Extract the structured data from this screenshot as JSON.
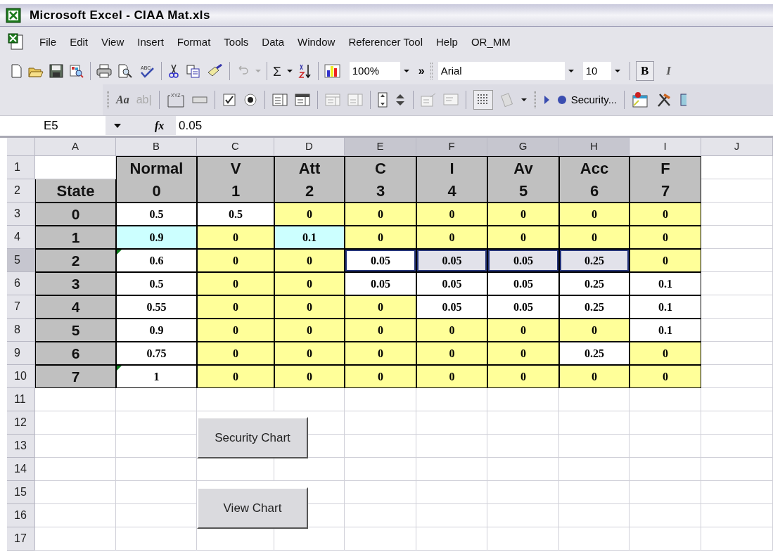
{
  "window": {
    "title": "Microsoft Excel - CIAA Mat.xls"
  },
  "menu": [
    {
      "label": "File"
    },
    {
      "label": "Edit"
    },
    {
      "label": "View"
    },
    {
      "label": "Insert"
    },
    {
      "label": "Format"
    },
    {
      "label": "Tools"
    },
    {
      "label": "Data"
    },
    {
      "label": "Window"
    },
    {
      "label": "Referencer Tool"
    },
    {
      "label": "Help"
    },
    {
      "label": "OR_MM"
    }
  ],
  "standard_toolbar": {
    "spelling_icon_text": "ABC",
    "sum": "Σ",
    "zoom": "100%",
    "overflow": "»",
    "font": "Arial",
    "font_size": "10",
    "bold": "B",
    "italic": "I"
  },
  "forms_toolbar": {
    "label_tool": "Aa",
    "edit_box_tool": "ab|",
    "group_box_text": "XYZ",
    "security_button": "Security..."
  },
  "formula_bar": {
    "name_box": "E5",
    "function_label": "fx",
    "formula": "0.05"
  },
  "columns": [
    {
      "label": "A",
      "selected": false
    },
    {
      "label": "B",
      "selected": false
    },
    {
      "label": "C",
      "selected": false
    },
    {
      "label": "D",
      "selected": false
    },
    {
      "label": "E",
      "selected": true
    },
    {
      "label": "F",
      "selected": true
    },
    {
      "label": "G",
      "selected": true
    },
    {
      "label": "H",
      "selected": true
    },
    {
      "label": "I",
      "selected": false
    },
    {
      "label": "J",
      "selected": false
    }
  ],
  "rows": [
    {
      "label": "1",
      "selected": false,
      "cells": [
        {
          "kind": "blank",
          "color": "#ffffff",
          "selected": false,
          "active": false,
          "flag": false
        },
        {
          "text": "Normal",
          "kind": "header",
          "color": "#c0c0c0",
          "selected": false,
          "active": false,
          "flag": false
        },
        {
          "text": "V",
          "kind": "header",
          "color": "#c0c0c0",
          "selected": false,
          "active": false,
          "flag": false
        },
        {
          "text": "Att",
          "kind": "header",
          "color": "#c0c0c0",
          "selected": false,
          "active": false,
          "flag": false
        },
        {
          "text": "C",
          "kind": "header",
          "color": "#c0c0c0",
          "selected": false,
          "active": false,
          "flag": false
        },
        {
          "text": "I",
          "kind": "header",
          "color": "#c0c0c0",
          "selected": false,
          "active": false,
          "flag": false
        },
        {
          "text": "Av",
          "kind": "header",
          "color": "#c0c0c0",
          "selected": false,
          "active": false,
          "flag": false
        },
        {
          "text": "Acc",
          "kind": "header",
          "color": "#c0c0c0",
          "selected": false,
          "active": false,
          "flag": false
        },
        {
          "text": "F",
          "kind": "header",
          "color": "#c0c0c0",
          "selected": false,
          "active": false,
          "flag": false
        }
      ]
    },
    {
      "label": "2",
      "selected": false,
      "cells": [
        {
          "text": "State",
          "kind": "header",
          "color": "#c0c0c0",
          "selected": false,
          "active": false,
          "flag": false
        },
        {
          "text": "0",
          "kind": "header",
          "color": "#c0c0c0",
          "selected": false,
          "active": false,
          "flag": false
        },
        {
          "text": "1",
          "kind": "header",
          "color": "#c0c0c0",
          "selected": false,
          "active": false,
          "flag": false
        },
        {
          "text": "2",
          "kind": "header",
          "color": "#c0c0c0",
          "selected": false,
          "active": false,
          "flag": false
        },
        {
          "text": "3",
          "kind": "header",
          "color": "#c0c0c0",
          "selected": false,
          "active": false,
          "flag": false
        },
        {
          "text": "4",
          "kind": "header",
          "color": "#c0c0c0",
          "selected": false,
          "active": false,
          "flag": false
        },
        {
          "text": "5",
          "kind": "header",
          "color": "#c0c0c0",
          "selected": false,
          "active": false,
          "flag": false
        },
        {
          "text": "6",
          "kind": "header",
          "color": "#c0c0c0",
          "selected": false,
          "active": false,
          "flag": false
        },
        {
          "text": "7",
          "kind": "header",
          "color": "#c0c0c0",
          "selected": false,
          "active": false,
          "flag": false
        }
      ]
    },
    {
      "label": "3",
      "selected": false,
      "cells": [
        {
          "text": "0",
          "kind": "label",
          "color": "#c0c0c0",
          "selected": false,
          "active": false,
          "flag": false
        },
        {
          "text": "0.5",
          "kind": "value",
          "color": "#ffffff",
          "selected": false,
          "active": false,
          "flag": false
        },
        {
          "text": "0.5",
          "kind": "value",
          "color": "#ffffff",
          "selected": false,
          "active": false,
          "flag": false
        },
        {
          "text": "0",
          "kind": "value",
          "color": "#ffff99",
          "selected": false,
          "active": false,
          "flag": false
        },
        {
          "text": "0",
          "kind": "value",
          "color": "#ffff99",
          "selected": false,
          "active": false,
          "flag": false
        },
        {
          "text": "0",
          "kind": "value",
          "color": "#ffff99",
          "selected": false,
          "active": false,
          "flag": false
        },
        {
          "text": "0",
          "kind": "value",
          "color": "#ffff99",
          "selected": false,
          "active": false,
          "flag": false
        },
        {
          "text": "0",
          "kind": "value",
          "color": "#ffff99",
          "selected": false,
          "active": false,
          "flag": false
        },
        {
          "text": "0",
          "kind": "value",
          "color": "#ffff99",
          "selected": false,
          "active": false,
          "flag": false
        }
      ]
    },
    {
      "label": "4",
      "selected": false,
      "cells": [
        {
          "text": "1",
          "kind": "label",
          "color": "#c0c0c0",
          "selected": false,
          "active": false,
          "flag": false
        },
        {
          "text": "0.9",
          "kind": "value",
          "color": "#ccffff",
          "selected": false,
          "active": false,
          "flag": false
        },
        {
          "text": "0",
          "kind": "value",
          "color": "#ffff99",
          "selected": false,
          "active": false,
          "flag": false
        },
        {
          "text": "0.1",
          "kind": "value",
          "color": "#ccffff",
          "selected": false,
          "active": false,
          "flag": false
        },
        {
          "text": "0",
          "kind": "value",
          "color": "#ffff99",
          "selected": false,
          "active": false,
          "flag": false
        },
        {
          "text": "0",
          "kind": "value",
          "color": "#ffff99",
          "selected": false,
          "active": false,
          "flag": false
        },
        {
          "text": "0",
          "kind": "value",
          "color": "#ffff99",
          "selected": false,
          "active": false,
          "flag": false
        },
        {
          "text": "0",
          "kind": "value",
          "color": "#ffff99",
          "selected": false,
          "active": false,
          "flag": false
        },
        {
          "text": "0",
          "kind": "value",
          "color": "#ffff99",
          "selected": false,
          "active": false,
          "flag": false
        }
      ]
    },
    {
      "label": "5",
      "selected": true,
      "cells": [
        {
          "text": "2",
          "kind": "label",
          "color": "#c0c0c0",
          "selected": false,
          "active": false,
          "flag": false
        },
        {
          "text": "0.6",
          "kind": "value",
          "color": "#ffffff",
          "selected": false,
          "active": false,
          "flag": true
        },
        {
          "text": "0",
          "kind": "value",
          "color": "#ffff99",
          "selected": false,
          "active": false,
          "flag": false
        },
        {
          "text": "0",
          "kind": "value",
          "color": "#ffff99",
          "selected": false,
          "active": false,
          "flag": false
        },
        {
          "text": "0.05",
          "kind": "value",
          "color": "#ffffff",
          "selected": true,
          "active": true,
          "flag": false
        },
        {
          "text": "0.05",
          "kind": "value",
          "color": "#e2e2ea",
          "selected": true,
          "active": false,
          "flag": false
        },
        {
          "text": "0.05",
          "kind": "value",
          "color": "#e2e2ea",
          "selected": true,
          "active": false,
          "flag": false
        },
        {
          "text": "0.25",
          "kind": "value",
          "color": "#e2e2ea",
          "selected": true,
          "active": false,
          "flag": false
        },
        {
          "text": "0",
          "kind": "value",
          "color": "#ffff99",
          "selected": false,
          "active": false,
          "flag": false
        }
      ]
    },
    {
      "label": "6",
      "selected": false,
      "cells": [
        {
          "text": "3",
          "kind": "label",
          "color": "#c0c0c0",
          "selected": false,
          "active": false,
          "flag": false
        },
        {
          "text": "0.5",
          "kind": "value",
          "color": "#ffffff",
          "selected": false,
          "active": false,
          "flag": false
        },
        {
          "text": "0",
          "kind": "value",
          "color": "#ffff99",
          "selected": false,
          "active": false,
          "flag": false
        },
        {
          "text": "0",
          "kind": "value",
          "color": "#ffff99",
          "selected": false,
          "active": false,
          "flag": false
        },
        {
          "text": "0.05",
          "kind": "value",
          "color": "#ffffff",
          "selected": false,
          "active": false,
          "flag": false
        },
        {
          "text": "0.05",
          "kind": "value",
          "color": "#ffffff",
          "selected": false,
          "active": false,
          "flag": false
        },
        {
          "text": "0.05",
          "kind": "value",
          "color": "#ffffff",
          "selected": false,
          "active": false,
          "flag": false
        },
        {
          "text": "0.25",
          "kind": "value",
          "color": "#ffffff",
          "selected": false,
          "active": false,
          "flag": false
        },
        {
          "text": "0.1",
          "kind": "value",
          "color": "#ffffff",
          "selected": false,
          "active": false,
          "flag": false
        }
      ]
    },
    {
      "label": "7",
      "selected": false,
      "cells": [
        {
          "text": "4",
          "kind": "label",
          "color": "#c0c0c0",
          "selected": false,
          "active": false,
          "flag": false
        },
        {
          "text": "0.55",
          "kind": "value",
          "color": "#ffffff",
          "selected": false,
          "active": false,
          "flag": false
        },
        {
          "text": "0",
          "kind": "value",
          "color": "#ffff99",
          "selected": false,
          "active": false,
          "flag": false
        },
        {
          "text": "0",
          "kind": "value",
          "color": "#ffff99",
          "selected": false,
          "active": false,
          "flag": false
        },
        {
          "text": "0",
          "kind": "value",
          "color": "#ffff99",
          "selected": false,
          "active": false,
          "flag": false
        },
        {
          "text": "0.05",
          "kind": "value",
          "color": "#ffffff",
          "selected": false,
          "active": false,
          "flag": false
        },
        {
          "text": "0.05",
          "kind": "value",
          "color": "#ffffff",
          "selected": false,
          "active": false,
          "flag": false
        },
        {
          "text": "0.25",
          "kind": "value",
          "color": "#ffffff",
          "selected": false,
          "active": false,
          "flag": false
        },
        {
          "text": "0.1",
          "kind": "value",
          "color": "#ffffff",
          "selected": false,
          "active": false,
          "flag": false
        }
      ]
    },
    {
      "label": "8",
      "selected": false,
      "cells": [
        {
          "text": "5",
          "kind": "label",
          "color": "#c0c0c0",
          "selected": false,
          "active": false,
          "flag": false
        },
        {
          "text": "0.9",
          "kind": "value",
          "color": "#ffffff",
          "selected": false,
          "active": false,
          "flag": false
        },
        {
          "text": "0",
          "kind": "value",
          "color": "#ffff99",
          "selected": false,
          "active": false,
          "flag": false
        },
        {
          "text": "0",
          "kind": "value",
          "color": "#ffff99",
          "selected": false,
          "active": false,
          "flag": false
        },
        {
          "text": "0",
          "kind": "value",
          "color": "#ffff99",
          "selected": false,
          "active": false,
          "flag": false
        },
        {
          "text": "0",
          "kind": "value",
          "color": "#ffff99",
          "selected": false,
          "active": false,
          "flag": false
        },
        {
          "text": "0",
          "kind": "value",
          "color": "#ffff99",
          "selected": false,
          "active": false,
          "flag": false
        },
        {
          "text": "0",
          "kind": "value",
          "color": "#ffff99",
          "selected": false,
          "active": false,
          "flag": false
        },
        {
          "text": "0.1",
          "kind": "value",
          "color": "#ffffff",
          "selected": false,
          "active": false,
          "flag": false
        }
      ]
    },
    {
      "label": "9",
      "selected": false,
      "cells": [
        {
          "text": "6",
          "kind": "label",
          "color": "#c0c0c0",
          "selected": false,
          "active": false,
          "flag": false
        },
        {
          "text": "0.75",
          "kind": "value",
          "color": "#ffffff",
          "selected": false,
          "active": false,
          "flag": false
        },
        {
          "text": "0",
          "kind": "value",
          "color": "#ffff99",
          "selected": false,
          "active": false,
          "flag": false
        },
        {
          "text": "0",
          "kind": "value",
          "color": "#ffff99",
          "selected": false,
          "active": false,
          "flag": false
        },
        {
          "text": "0",
          "kind": "value",
          "color": "#ffff99",
          "selected": false,
          "active": false,
          "flag": false
        },
        {
          "text": "0",
          "kind": "value",
          "color": "#ffff99",
          "selected": false,
          "active": false,
          "flag": false
        },
        {
          "text": "0",
          "kind": "value",
          "color": "#ffff99",
          "selected": false,
          "active": false,
          "flag": false
        },
        {
          "text": "0.25",
          "kind": "value",
          "color": "#ffffff",
          "selected": false,
          "active": false,
          "flag": false
        },
        {
          "text": "0",
          "kind": "value",
          "color": "#ffff99",
          "selected": false,
          "active": false,
          "flag": false
        }
      ]
    },
    {
      "label": "10",
      "selected": false,
      "cells": [
        {
          "text": "7",
          "kind": "label",
          "color": "#c0c0c0",
          "selected": false,
          "active": false,
          "flag": false
        },
        {
          "text": "1",
          "kind": "value",
          "color": "#ffffff",
          "selected": false,
          "active": false,
          "flag": true
        },
        {
          "text": "0",
          "kind": "value",
          "color": "#ffff99",
          "selected": false,
          "active": false,
          "flag": false
        },
        {
          "text": "0",
          "kind": "value",
          "color": "#ffff99",
          "selected": false,
          "active": false,
          "flag": false
        },
        {
          "text": "0",
          "kind": "value",
          "color": "#ffff99",
          "selected": false,
          "active": false,
          "flag": false
        },
        {
          "text": "0",
          "kind": "value",
          "color": "#ffff99",
          "selected": false,
          "active": false,
          "flag": false
        },
        {
          "text": "0",
          "kind": "value",
          "color": "#ffff99",
          "selected": false,
          "active": false,
          "flag": false
        },
        {
          "text": "0",
          "kind": "value",
          "color": "#ffff99",
          "selected": false,
          "active": false,
          "flag": false
        },
        {
          "text": "0",
          "kind": "value",
          "color": "#ffff99",
          "selected": false,
          "active": false,
          "flag": false
        }
      ]
    },
    {
      "label": "11",
      "selected": false
    },
    {
      "label": "12",
      "selected": false
    },
    {
      "label": "13",
      "selected": false
    },
    {
      "label": "14",
      "selected": false
    },
    {
      "label": "15",
      "selected": false
    },
    {
      "label": "16",
      "selected": false
    },
    {
      "label": "17",
      "selected": false
    }
  ],
  "buttons": [
    {
      "label": "Security Chart"
    },
    {
      "label": "View Chart"
    }
  ]
}
